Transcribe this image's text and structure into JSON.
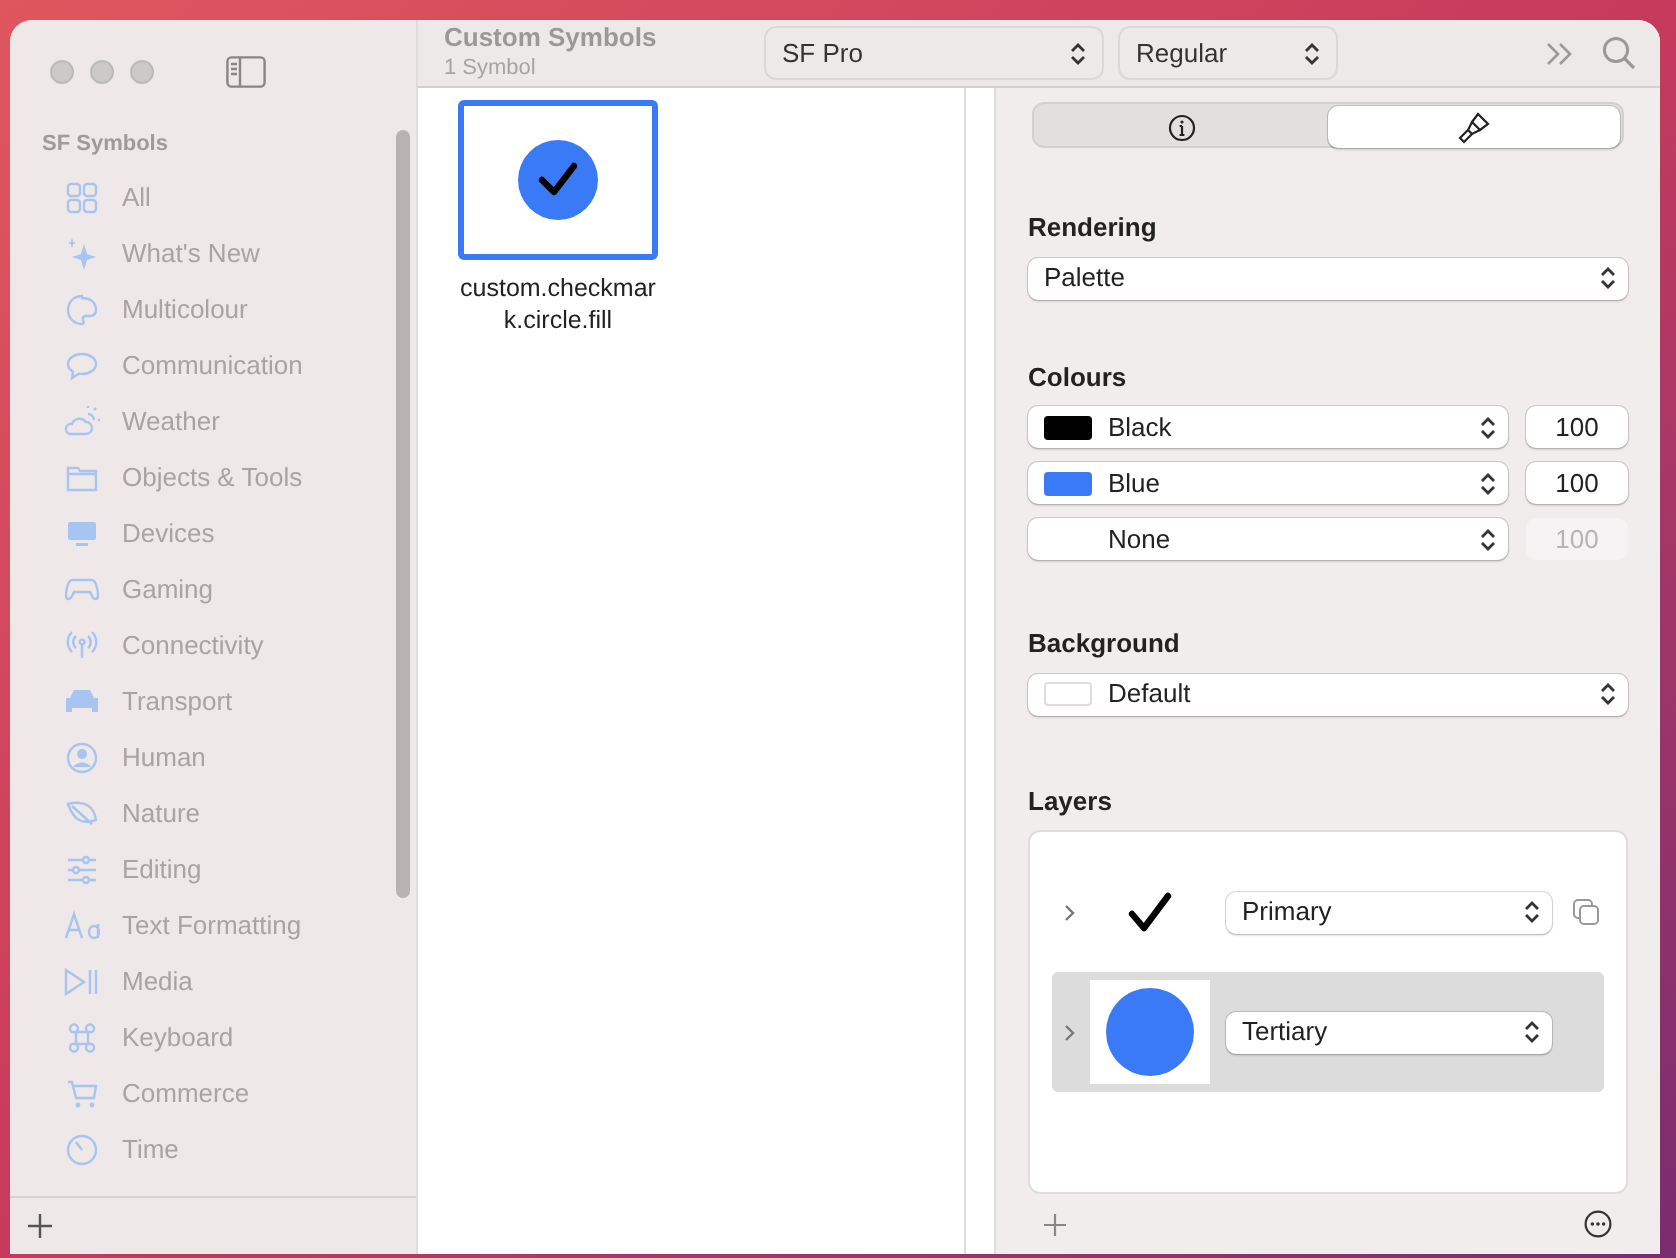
{
  "toolbar": {
    "title": "Custom Symbols",
    "subtitle": "1 Symbol",
    "font_popup": "SF Pro",
    "weight_popup": "Regular"
  },
  "sidebar": {
    "heading": "SF Symbols",
    "items": [
      {
        "label": "All",
        "disabled": true
      },
      {
        "label": "What's New",
        "disabled": true
      },
      {
        "label": "Multicolour",
        "disabled": true
      },
      {
        "label": "Communication",
        "disabled": true
      },
      {
        "label": "Weather",
        "disabled": true
      },
      {
        "label": "Objects & Tools",
        "disabled": true
      },
      {
        "label": "Devices",
        "disabled": true
      },
      {
        "label": "Gaming",
        "disabled": true
      },
      {
        "label": "Connectivity",
        "disabled": true
      },
      {
        "label": "Transport",
        "disabled": true
      },
      {
        "label": "Human",
        "disabled": true
      },
      {
        "label": "Nature",
        "disabled": true
      },
      {
        "label": "Editing",
        "disabled": true
      },
      {
        "label": "Text Formatting",
        "disabled": true
      },
      {
        "label": "Media",
        "disabled": true
      },
      {
        "label": "Keyboard",
        "disabled": true
      },
      {
        "label": "Commerce",
        "disabled": true
      },
      {
        "label": "Time",
        "disabled": true
      }
    ]
  },
  "symbols": [
    {
      "name": "custom.checkmark.circle.fill",
      "selected": true
    }
  ],
  "inspector": {
    "tabs": [
      {
        "kind": "info",
        "selected": false
      },
      {
        "kind": "paint",
        "selected": true
      }
    ],
    "rendering": {
      "label": "Rendering",
      "value": "Palette"
    },
    "colours": {
      "label": "Colours",
      "rows": [
        {
          "name": "Black",
          "color": "#000000",
          "opacity": "100",
          "disabled": false
        },
        {
          "name": "Blue",
          "color": "#3b7af6",
          "opacity": "100",
          "disabled": false
        },
        {
          "name": "None",
          "opacity": "100",
          "disabled": true
        }
      ]
    },
    "background": {
      "label": "Background",
      "value": "Default"
    },
    "layers": {
      "label": "Layers",
      "items": [
        {
          "kind": "checkmark",
          "value": "Primary",
          "selected": false
        },
        {
          "kind": "circle",
          "value": "Tertiary",
          "selected": true
        }
      ]
    }
  }
}
